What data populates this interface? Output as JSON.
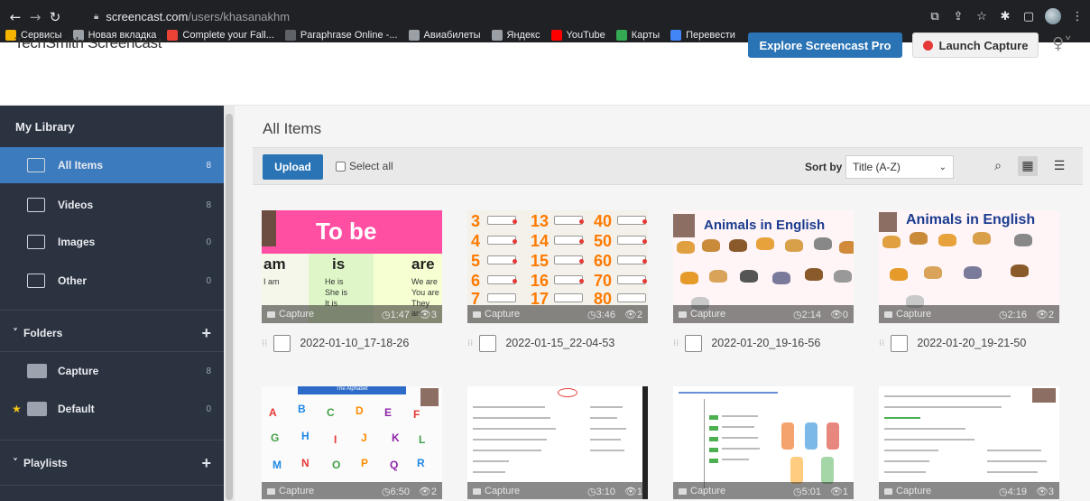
{
  "browser": {
    "url_host": "screencast.com",
    "url_path": "/users/khasanakhm",
    "bookmarks": [
      {
        "label": "Сервисы",
        "color": "#f4b400"
      },
      {
        "label": "Новая вкладка",
        "color": "#9aa0a6"
      },
      {
        "label": "Complete your Fall...",
        "color": "#ea4335"
      },
      {
        "label": "Paraphrase Online -...",
        "color": "#5f6368"
      },
      {
        "label": "Авиабилеты",
        "color": "#9aa0a6"
      },
      {
        "label": "Яндекс",
        "color": "#9aa0a6"
      },
      {
        "label": "YouTube",
        "color": "#ff0000"
      },
      {
        "label": "Карты",
        "color": "#34a853"
      },
      {
        "label": "Перевести",
        "color": "#4285f4"
      }
    ]
  },
  "header": {
    "logo": "TechSmith Screencast",
    "explore_label": "Explore Screencast Pro",
    "capture_label": "Launch Capture",
    "accent": "#2a74b5"
  },
  "sidebar": {
    "library_title": "My Library",
    "items": [
      {
        "label": "All Items",
        "count": "8"
      },
      {
        "label": "Videos",
        "count": "8"
      },
      {
        "label": "Images",
        "count": "0"
      },
      {
        "label": "Other",
        "count": "0"
      }
    ],
    "folders_title": "Folders",
    "folders": [
      {
        "label": "Capture",
        "count": "8"
      },
      {
        "label": "Default",
        "count": "0"
      }
    ],
    "playlists_title": "Playlists"
  },
  "main": {
    "title": "All Items",
    "upload_label": "Upload",
    "select_all_label": "Select all",
    "sort_by_label": "Sort by",
    "sort_value": "Title (A-Z)",
    "cards": [
      {
        "folder": "Capture",
        "duration": "1:47",
        "views": "3",
        "title": "2022-01-10_17-18-26"
      },
      {
        "folder": "Capture",
        "duration": "3:46",
        "views": "2",
        "title": "2022-01-15_22-04-53"
      },
      {
        "folder": "Capture",
        "duration": "2:14",
        "views": "0",
        "title": "2022-01-20_19-16-56"
      },
      {
        "folder": "Capture",
        "duration": "2:16",
        "views": "2",
        "title": "2022-01-20_19-21-50"
      },
      {
        "folder": "Capture",
        "duration": "6:50",
        "views": "2",
        "title": ""
      },
      {
        "folder": "Capture",
        "duration": "3:10",
        "views": "1",
        "title": ""
      },
      {
        "folder": "Capture",
        "duration": "5:01",
        "views": "1",
        "title": ""
      },
      {
        "folder": "Capture",
        "duration": "4:19",
        "views": "3",
        "title": ""
      }
    ],
    "thumb_text": {
      "to_be": "To be",
      "am": "am",
      "is": "is",
      "are": "are",
      "i_am": "I am",
      "he_is": "He is",
      "she_is": "She is",
      "it_is": "It is",
      "we_are": "We are",
      "you_are": "You are",
      "they_are": "They are",
      "animals": "Animals in English",
      "alphabet": "The Alphabet"
    }
  }
}
